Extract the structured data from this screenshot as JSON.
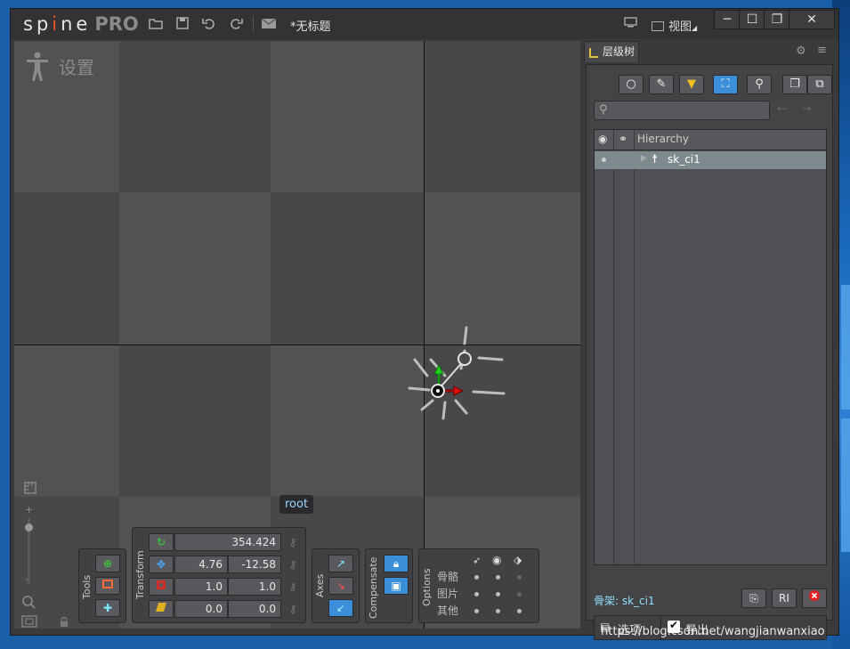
{
  "app": {
    "logo_main": "sp",
    "logo_i": "i",
    "logo_rest": "ne",
    "logo_pro": "PRO",
    "document_title": "*无标题",
    "view_menu": "视图",
    "mode": "设置"
  },
  "toolbar_icons": [
    "folder-open-icon",
    "save-icon",
    "undo-icon",
    "redo-icon",
    "envelope-icon"
  ],
  "window_controls": [
    "minimize",
    "maximize",
    "restore",
    "close"
  ],
  "viewport": {
    "bone_tooltip": "root"
  },
  "tools_panel": {
    "label": "Tools",
    "buttons": [
      "pose-tool",
      "weights-tool",
      "create-tool"
    ]
  },
  "transform_panel": {
    "label": "Transform",
    "rotate": "354.424",
    "translate_x": "4.76",
    "translate_y": "-12.58",
    "scale_x": "1.0",
    "scale_y": "1.0",
    "shear_x": "0.0",
    "shear_y": "0.0"
  },
  "axes_panel": {
    "label": "Axes"
  },
  "compensate_panel": {
    "label": "Compensate"
  },
  "options_panel": {
    "label": "Options",
    "rows": [
      "骨骼",
      "图片",
      "其他"
    ]
  },
  "hierarchy": {
    "tab_label": "层级树",
    "column_header": "Hierarchy",
    "items": [
      {
        "label": "sk_ci1"
      }
    ],
    "selection_label": "骨架: sk_ci1",
    "options_button": "选项",
    "export_checkbox": "导出",
    "export_checked": true
  },
  "colors": {
    "accent": "#3a8fd8",
    "selection_text": "#8fe0ff",
    "x_axis": "#e01010",
    "y_axis": "#20d020"
  },
  "watermark": "https://blog.csdn.net/wangjianwanxiao"
}
